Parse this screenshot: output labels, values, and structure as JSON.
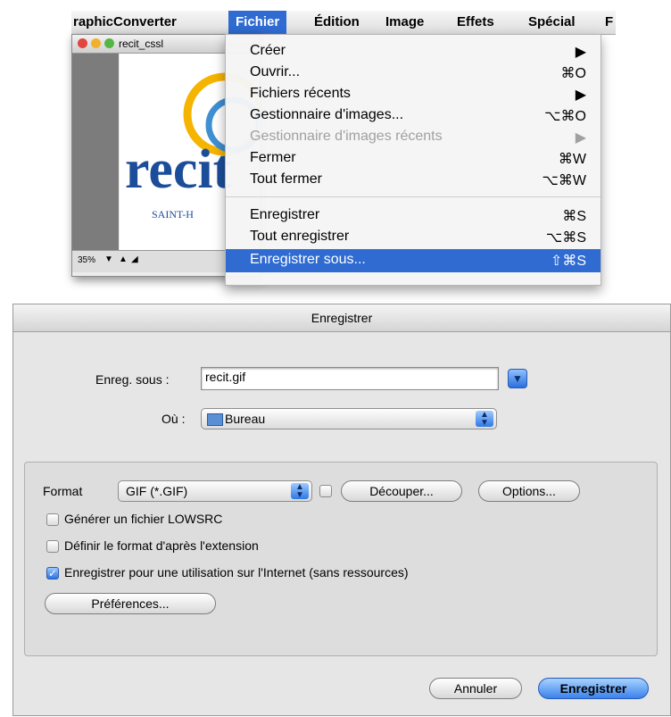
{
  "menubar": {
    "app_name": "raphicConverter",
    "menus": [
      "Fichier",
      "Édition",
      "Image",
      "Effets",
      "Spécial",
      "F"
    ],
    "active_menu": "Fichier"
  },
  "document_window": {
    "title": "recit_cssl",
    "zoom": "35%",
    "logo_text": "recit",
    "logo_subtext": "SAINT-H"
  },
  "fichier_menu": {
    "items": [
      {
        "label": "Créer",
        "shortcut": "▶",
        "enabled": true
      },
      {
        "label": "Ouvrir...",
        "shortcut": "⌘O",
        "enabled": true
      },
      {
        "label": "Fichiers récents",
        "shortcut": "▶",
        "enabled": true
      },
      {
        "label": "Gestionnaire d'images...",
        "shortcut": "⌥⌘O",
        "enabled": true
      },
      {
        "label": "Gestionnaire d'images récents",
        "shortcut": "▶",
        "enabled": false
      },
      {
        "label": "Fermer",
        "shortcut": "⌘W",
        "enabled": true
      },
      {
        "label": "Tout fermer",
        "shortcut": "⌥⌘W",
        "enabled": true
      },
      {
        "label": "Enregistrer",
        "shortcut": "⌘S",
        "enabled": true
      },
      {
        "label": "Tout enregistrer",
        "shortcut": "⌥⌘S",
        "enabled": true
      },
      {
        "label": "Enregistrer sous...",
        "shortcut": "⇧⌘S",
        "enabled": true,
        "highlighted": true
      }
    ]
  },
  "save_dialog": {
    "title": "Enregistrer",
    "save_as_label": "Enreg. sous :",
    "filename": "recit.gif",
    "where_label": "Où :",
    "location": "Bureau",
    "format_label": "Format",
    "format_value": "GIF (*.GIF)",
    "crop_button": "Découper...",
    "options_button": "Options...",
    "checkboxes": [
      {
        "label": "Générer un fichier LOWSRC",
        "checked": false
      },
      {
        "label": "Définir le format d'après l'extension",
        "checked": false
      },
      {
        "label": "Enregistrer pour une utilisation sur l'Internet (sans ressources)",
        "checked": true
      }
    ],
    "preferences_button": "Préférences...",
    "cancel_button": "Annuler",
    "save_button": "Enregistrer"
  },
  "colors": {
    "selection_blue": "#2f6bd1",
    "aqua_blue": "#3b82ea"
  }
}
